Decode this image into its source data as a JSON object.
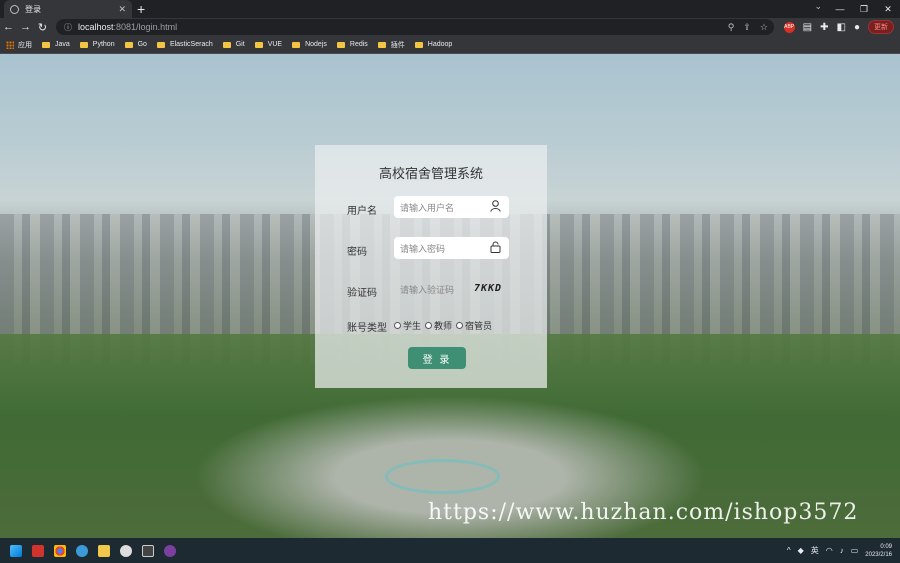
{
  "browser": {
    "tab_title": "登录",
    "url_host": "localhost",
    "url_path": ":8081/login.html",
    "update_label": "更新",
    "abp_label": "ABP"
  },
  "bookmarks": [
    "应用",
    "Java",
    "Python",
    "Go",
    "ElasticSerach",
    "Git",
    "VUE",
    "Nodejs",
    "Redis",
    "插件",
    "Hadoop"
  ],
  "login": {
    "title": "高校宿舍管理系统",
    "username_label": "用户名",
    "username_placeholder": "请输入用户名",
    "password_label": "密码",
    "password_placeholder": "请输入密码",
    "captcha_label": "验证码",
    "captcha_placeholder": "请输入验证码",
    "captcha_text": "7KKD",
    "account_type_label": "账号类型",
    "account_types": [
      "学生",
      "教师",
      "宿管员"
    ],
    "submit_label": "登 录"
  },
  "watermark": "https://www.huzhan.com/ishop3572",
  "taskbar": {
    "ime": "英",
    "time": "0:09",
    "date": "2023/2/16"
  },
  "colors": {
    "accent": "#3f8f74",
    "chrome_dark": "#202124",
    "chrome_toolbar": "#35363a"
  }
}
